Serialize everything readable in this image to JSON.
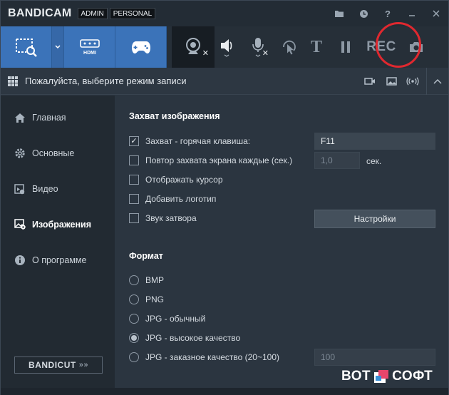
{
  "app": {
    "name": "BANDICAM",
    "tags": [
      "ADMIN",
      "PERSONAL"
    ]
  },
  "titlebar_icons": [
    "folder-icon",
    "clock-icon",
    "help-icon",
    "minimize-icon",
    "close-icon"
  ],
  "toolbar": {
    "modes": [
      "screen-rectangle-icon",
      "hdmi-icon",
      "gamepad-icon"
    ],
    "hdmi_label": "HDMI",
    "text_label": "T",
    "rec_label": "REC",
    "rec_highlight_color": "#e0282f"
  },
  "modebar": {
    "text": "Пожалуйста, выберите режим записи"
  },
  "sidebar": {
    "items": [
      {
        "label": "Главная",
        "icon": "home-icon"
      },
      {
        "label": "Основные",
        "icon": "gear-icon"
      },
      {
        "label": "Видео",
        "icon": "video-icon"
      },
      {
        "label": "Изображения",
        "icon": "image-settings-icon",
        "active": true
      },
      {
        "label": "О программе",
        "icon": "info-icon"
      }
    ],
    "bandicut": {
      "label": "BANDICUT",
      "arrows": "»»"
    }
  },
  "capture": {
    "title": "Захват изображения",
    "hotkey": {
      "label": "Захват - горячая клавиша:",
      "checked": true,
      "value": "F11"
    },
    "repeat": {
      "label": "Повтор захвата экрана каждые (сек.)",
      "checked": false,
      "value": "1,0",
      "unit": "сек."
    },
    "cursor": {
      "label": "Отображать курсор",
      "checked": false
    },
    "logo": {
      "label": "Добавить логотип",
      "checked": false
    },
    "shutter": {
      "label": "Звук затвора",
      "checked": false
    },
    "settings_button": "Настройки"
  },
  "format": {
    "title": "Формат",
    "options": [
      {
        "label": "BMP",
        "selected": false
      },
      {
        "label": "PNG",
        "selected": false
      },
      {
        "label": "JPG - обычный",
        "selected": false
      },
      {
        "label": "JPG - высокое качество",
        "selected": true
      },
      {
        "label": "JPG - заказное качество (20~100)",
        "selected": false
      }
    ],
    "quality_value": "100"
  },
  "watermark": {
    "left": "ВОТ",
    "right": "СОФТ"
  }
}
